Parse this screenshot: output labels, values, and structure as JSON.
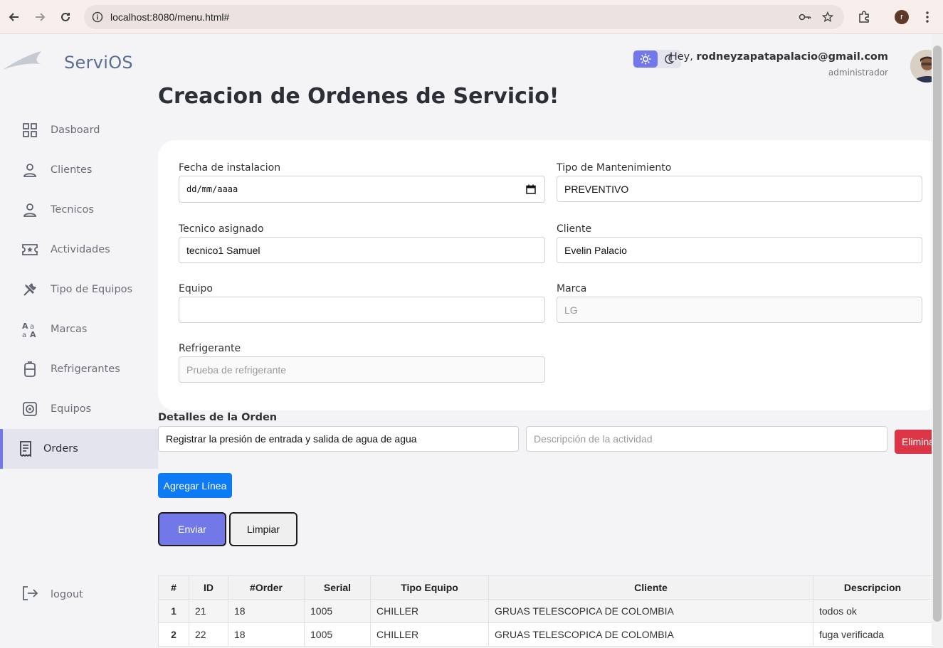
{
  "browser": {
    "url": "localhost:8080/menu.html#",
    "profile_initial": "r"
  },
  "brand": {
    "name": "ServiOS"
  },
  "sidebar": {
    "items": [
      {
        "label": "Dasboard",
        "icon": "grid-icon"
      },
      {
        "label": "Clientes",
        "icon": "user-icon"
      },
      {
        "label": "Tecnicos",
        "icon": "user-icon"
      },
      {
        "label": "Actividades",
        "icon": "ticket-icon"
      },
      {
        "label": "Tipo de Equipos",
        "icon": "tools-icon"
      },
      {
        "label": "Marcas",
        "icon": "text-icon"
      },
      {
        "label": "Refrigerantes",
        "icon": "tank-icon"
      },
      {
        "label": "Equipos",
        "icon": "device-icon"
      },
      {
        "label": "Orders",
        "icon": "receipt-icon",
        "active": true
      }
    ],
    "logout_label": "logout"
  },
  "header": {
    "greeting_prefix": "Hey,",
    "user_email": "rodneyzapatapalacio@gmail.com",
    "role": "administrador"
  },
  "page": {
    "title": "Creacion de Ordenes de Servicio!"
  },
  "form": {
    "fecha_label": "Fecha de instalacion",
    "fecha_value": "dd/mm/aaaa",
    "tipo_label": "Tipo de Mantenimiento",
    "tipo_value": "PREVENTIVO",
    "tecnico_label": "Tecnico asignado",
    "tecnico_value": "tecnico1 Samuel",
    "cliente_label": "Cliente",
    "cliente_value": "Evelin Palacio",
    "equipo_label": "Equipo",
    "equipo_value": "",
    "marca_label": "Marca",
    "marca_placeholder": "LG",
    "refrigerante_label": "Refrigerante",
    "refrigerante_placeholder": "Prueba de refrigerante"
  },
  "details": {
    "label": "Detalles de la Orden",
    "line_value": "Registrar la presión de entrada y salida de agua de agua",
    "description_placeholder": "Descripción de la actividad",
    "delete_label": "Elimina",
    "add_label": "Agregar Línea"
  },
  "actions": {
    "send_label": "Enviar",
    "clear_label": "Limpiar"
  },
  "table": {
    "headers": [
      "#",
      "ID",
      "#Order",
      "Serial",
      "Tipo Equipo",
      "Cliente",
      "Descripcion"
    ],
    "rows": [
      [
        "1",
        "21",
        "18",
        "1005",
        "CHILLER",
        "GRUAS TELESCOPICA DE COLOMBIA",
        "todos ok"
      ],
      [
        "2",
        "22",
        "18",
        "1005",
        "CHILLER",
        "GRUAS TELESCOPICA DE COLOMBIA",
        "fuga verificada"
      ]
    ]
  },
  "colors": {
    "accent": "#7278e8",
    "danger": "#dc3545",
    "primary": "#0d7bf5"
  }
}
